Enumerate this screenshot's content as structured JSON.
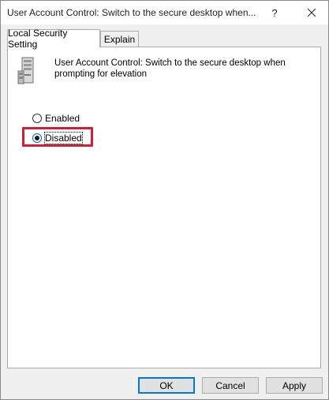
{
  "window": {
    "title": "User Account Control: Switch to the secure desktop when...",
    "help_label": "?",
    "close_icon": "close-icon"
  },
  "tabs": [
    {
      "label": "Local Security Setting",
      "active": true
    },
    {
      "label": "Explain",
      "active": false
    }
  ],
  "policy": {
    "icon": "server-icon",
    "description": "User Account Control: Switch to the secure desktop when prompting for elevation"
  },
  "options": {
    "enabled_label": "Enabled",
    "disabled_label": "Disabled",
    "selected": "Disabled"
  },
  "highlight_color": "#d11f36",
  "buttons": {
    "ok": "OK",
    "cancel": "Cancel",
    "apply": "Apply"
  }
}
